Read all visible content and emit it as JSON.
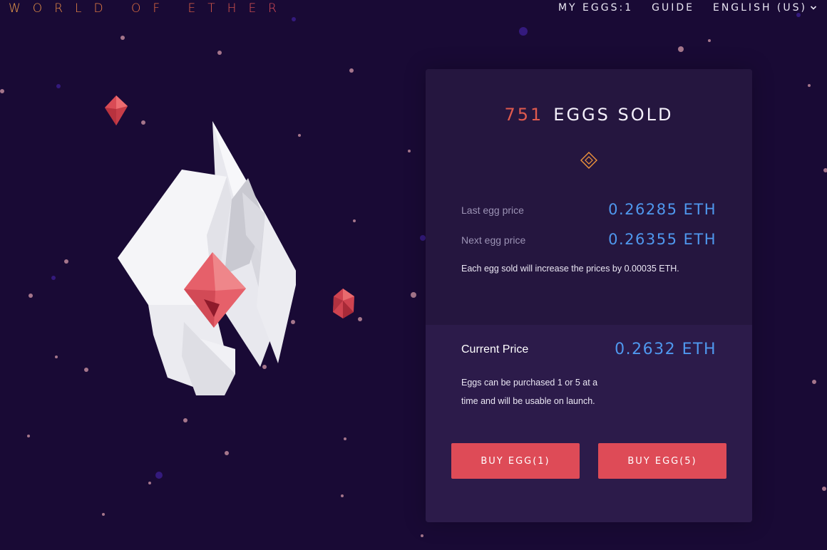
{
  "header": {
    "logo_text": "WORLD OF ETHER",
    "nav": {
      "my_eggs_label": "MY EGGS:1",
      "guide_label": "GUIDE",
      "language_label": "ENGLISH (US)"
    }
  },
  "sale": {
    "sold_count": "751",
    "sold_label": "EGGS SOLD",
    "last_price_label": "Last egg price",
    "last_price_value": "0.26285 ETH",
    "next_price_label": "Next egg price",
    "next_price_value": "0.26355 ETH",
    "increase_note": "Each egg sold will increase the prices by 0.00035 ETH.",
    "current_price_label": "Current Price",
    "current_price_value": "0.2632 ETH",
    "purchase_note": "Eggs can be purchased 1 or 5 at a time and will be usable on launch.",
    "buy_one_label": "BUY EGG(1)",
    "buy_five_label": "BUY EGG(5)"
  },
  "icons": {
    "chevron": "chevron-down-icon",
    "divider": "diamond-icon"
  },
  "colors": {
    "background": "#190a35",
    "panel": "#25163f",
    "accent_red": "#de4b57",
    "price_blue": "#4f98ee",
    "sold_count": "#e05a4e"
  }
}
